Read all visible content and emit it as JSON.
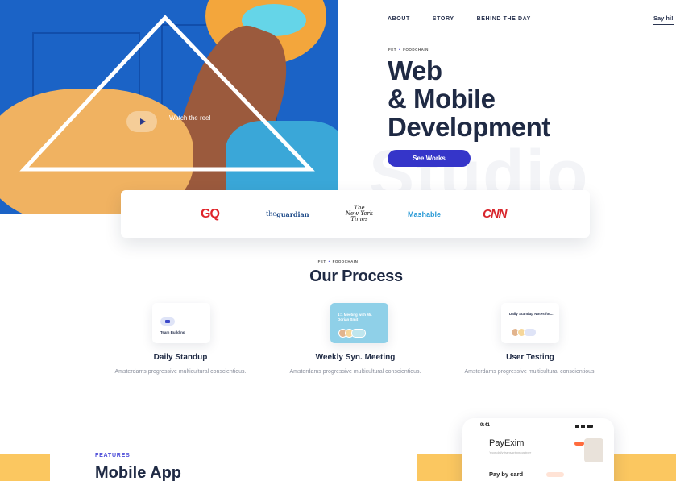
{
  "hero": {
    "watch_label": "Watch the reel"
  },
  "nav": {
    "items": [
      {
        "label": "ABOUT"
      },
      {
        "label": "STORY"
      },
      {
        "label": "BEHIND THE DAY"
      }
    ],
    "say_hi": "Say hi!"
  },
  "headline": {
    "breadcrumb_left": "FET",
    "breadcrumb_right": "FOODCHAIN",
    "lines": [
      "Web",
      "& Mobile",
      "Development"
    ],
    "cta_label": "See Works",
    "watermark": "Studio"
  },
  "press": {
    "gq": "GQ",
    "guardian_prefix": "the",
    "guardian_name": "guardian",
    "nyt_line1": "The",
    "nyt_line2": "New York",
    "nyt_line3": "Times",
    "mashable": "Mashable",
    "cnn": "CNN"
  },
  "process": {
    "breadcrumb_left": "FET",
    "breadcrumb_right": "FOODCHAIN",
    "title": "Our Process",
    "cards": [
      {
        "mini_text": "Team Building",
        "title": "Daily Standup",
        "desc": "Amsterdams progressive multicultural conscientious."
      },
      {
        "mini_text": "1:1 Meeting with Mr. Dorian Smit",
        "title": "Weekly Syn. Meeting",
        "desc": "Amsterdams progressive multicultural conscientious."
      },
      {
        "mini_text": "Daily Standup Notes for...",
        "title": "User Testing",
        "desc": "Amsterdams progressive multicultural conscientious."
      }
    ]
  },
  "features": {
    "eyebrow": "FEATURES",
    "title": "Mobile App"
  },
  "phone": {
    "time": "9:41",
    "brand": "PayExim",
    "subtitle": "Your daily transaction partner",
    "pay_label": "Pay by card"
  },
  "colors": {
    "hero_blue": "#1b63c6",
    "accent": "#3535c9",
    "ink": "#1f2a44",
    "yellow": "#fbc760",
    "gq_red": "#e0242a",
    "mashable_blue": "#2a9ad6",
    "cnn_red": "#d8262d"
  }
}
